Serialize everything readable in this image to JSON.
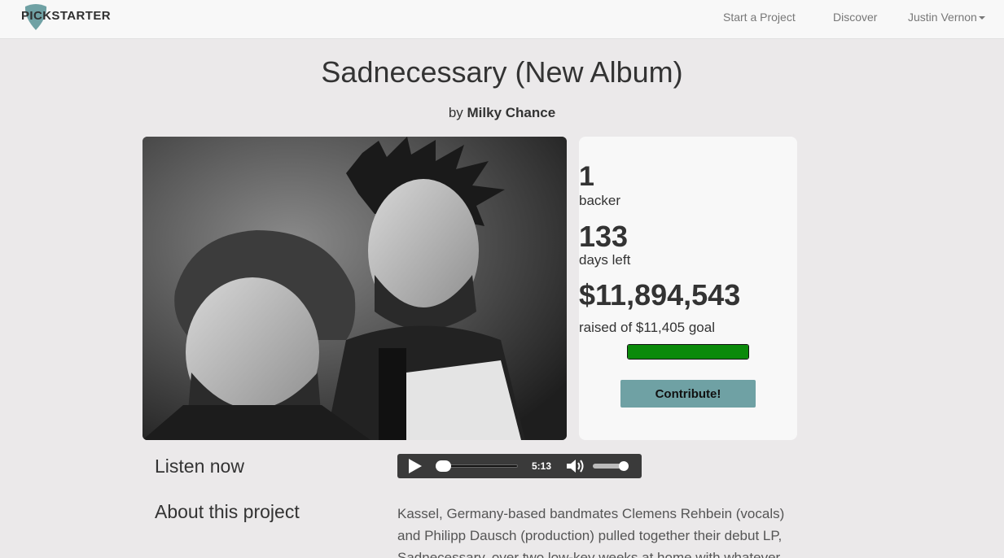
{
  "navbar": {
    "brand": "PICKSTARTER",
    "start_project": "Start a Project",
    "discover": "Discover",
    "user": "Justin Vernon",
    "brand_color": "#6fa1a4"
  },
  "project": {
    "title": "Sadnecessary (New Album)",
    "by_prefix": "by",
    "artist": "Milky Chance"
  },
  "stats": {
    "backers": "1",
    "backers_label": "backer",
    "days_left": "133",
    "days_label": "days left",
    "raised": "$11,894,543",
    "goal_label": "raised of $11,405 goal",
    "progress_fraction": 1.0,
    "progress_color": "#0a8a0a",
    "contribute_label": "Contribute!",
    "contribute_color": "#6fa1a4"
  },
  "listen": {
    "heading": "Listen now",
    "duration": "5:13",
    "play_icon": "play-icon",
    "volume_icon": "volume-icon"
  },
  "about": {
    "heading": "About this project",
    "text": "Kassel, Germany-based bandmates Clemens Rehbein (vocals) and Philipp Dausch (production) pulled together their debut LP, Sadnecessary, over two low-key weeks at home with whatever"
  }
}
